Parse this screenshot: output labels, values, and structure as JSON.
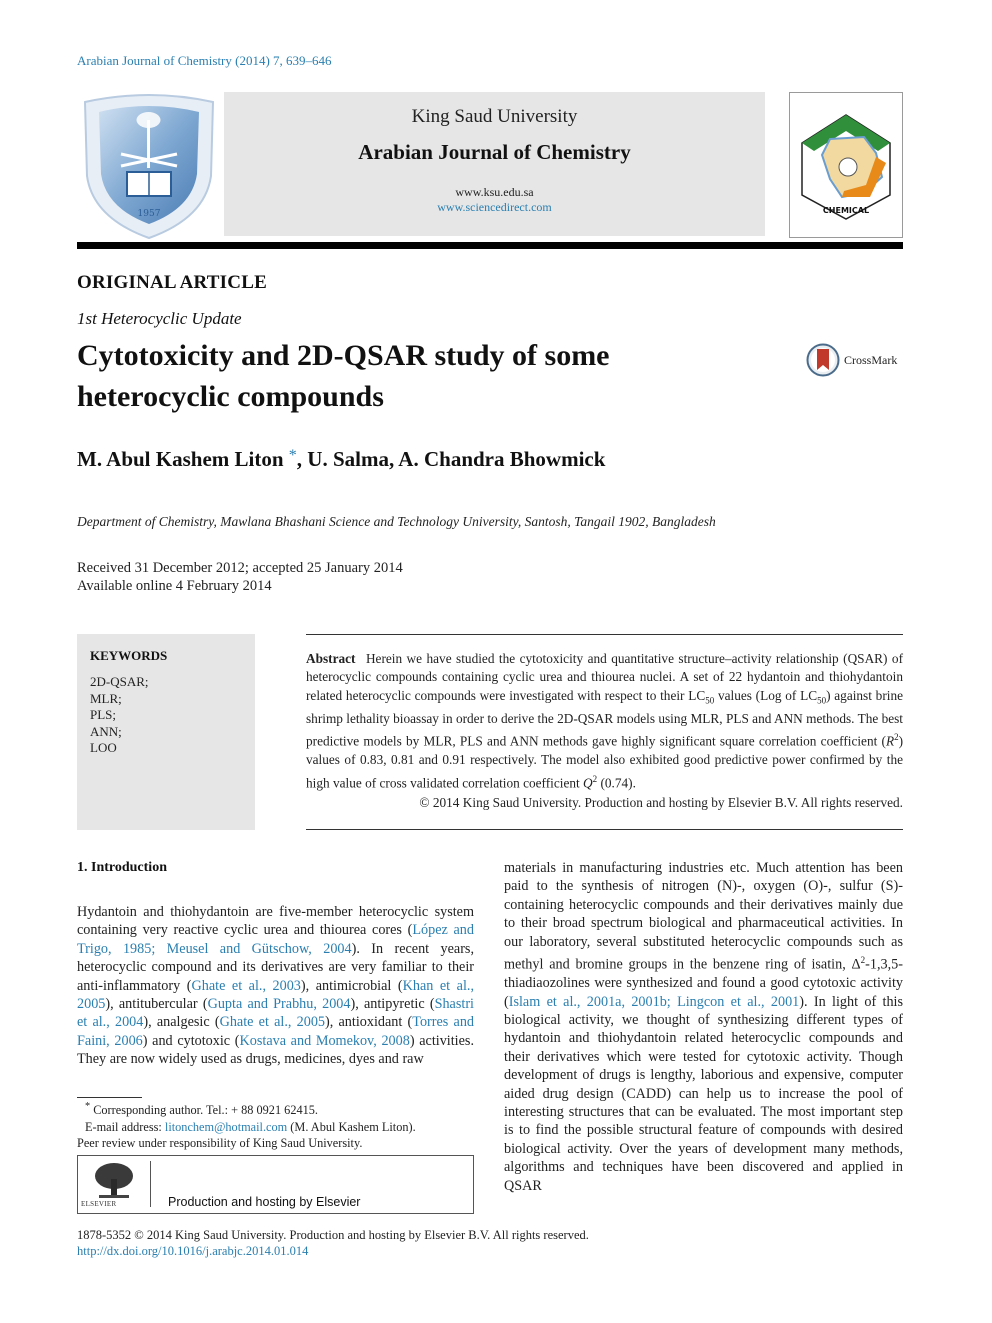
{
  "journal_ref": "Arabian Journal of Chemistry (2014) 7, 639–646",
  "header": {
    "university": "King Saud University",
    "journal_name": "Arabian Journal of Chemistry",
    "url_ksu": "www.ksu.edu.sa",
    "url_sciencedirect": "www.sciencedirect.com",
    "left_logo": "king-saud-university-crest",
    "right_logo": "saudi-chemical-society-emblem",
    "right_logo_text": "CHEMICAL"
  },
  "article": {
    "type": "ORIGINAL ARTICLE",
    "section": "1st Heterocyclic Update",
    "title": "Cytotoxicity and 2D-QSAR study of some heterocyclic compounds",
    "crossmark_label": "CrossMark",
    "authors": "M. Abul Kashem Liton",
    "authors_star": "*",
    "authors_rest": ", U. Salma, A. Chandra Bhowmick",
    "affiliation": "Department of Chemistry, Mawlana Bhashani Science and Technology University, Santosh, Tangail 1902, Bangladesh",
    "received": "Received 31 December 2012; accepted 25 January 2014",
    "available": "Available online 4 February 2014"
  },
  "keywords": {
    "heading": "KEYWORDS",
    "items": [
      "2D-QSAR;",
      "MLR;",
      "PLS;",
      "ANN;",
      "LOO"
    ]
  },
  "abstract": {
    "heading": "Abstract",
    "text_1": "Herein we have studied the cytotoxicity and quantitative structure–activity relationship (QSAR) of heterocyclic compounds containing cyclic urea and thiourea nuclei. A set of 22 hydantoin and thiohydantoin related heterocyclic compounds were investigated with respect to their LC",
    "sub_50": "50",
    "text_2": " values (Log of LC",
    "text_3": ") against brine shrimp lethality bioassay in order to derive the 2D-QSAR models using MLR, PLS and ANN methods. The best predictive models by MLR, PLS and ANN methods gave highly significant square correlation coefficient (",
    "r2_var": "R",
    "sup_2": "2",
    "text_4": ") values of 0.83, 0.81 and 0.91 respectively. The model also exhibited good predictive power confirmed by the high value of cross validated correlation coefficient ",
    "q2_var": "Q",
    "text_5": " (0.74).",
    "copyright": "© 2014 King Saud University. Production and hosting by Elsevier B.V. All rights reserved."
  },
  "introduction": {
    "heading": "1. Introduction",
    "left": [
      {
        "t": "Hydantoin and thiohydantoin are five-member heterocyclic system containing very reactive cyclic urea and thiourea cores ("
      },
      {
        "l": "López and Trigo, 1985; Meusel and Gütschow, 2004"
      },
      {
        "t": "). In recent years, heterocyclic compound and its derivatives are very familiar to their anti-inflammatory ("
      },
      {
        "l": "Ghate et al., 2003"
      },
      {
        "t": "), antimicrobial ("
      },
      {
        "l": "Khan et al., 2005"
      },
      {
        "t": "), antitubercular ("
      },
      {
        "l": "Gupta and Prabhu, 2004"
      },
      {
        "t": "), antipyretic ("
      },
      {
        "l": "Shastri et al., 2004"
      },
      {
        "t": "), analgesic ("
      },
      {
        "l": "Ghate et al., 2005"
      },
      {
        "t": "), antioxidant ("
      },
      {
        "l": "Torres and Faini, 2006"
      },
      {
        "t": ") and cytotoxic ("
      },
      {
        "l": "Kostava and Momekov, 2008"
      },
      {
        "t": ") activities. They are now widely used as drugs, medicines, dyes and raw"
      }
    ],
    "right": [
      {
        "t": "materials in manufacturing industries etc. Much attention has been paid to the synthesis of nitrogen (N)-, oxygen (O)-, sulfur (S)- containing heterocyclic compounds and their derivatives mainly due to their broad spectrum biological and pharmaceutical activities. In our laboratory, several substituted heterocyclic compounds such as methyl and bromine groups in the benzene ring of isatin, Δ"
      },
      {
        "s": "2"
      },
      {
        "t": "-1,3,5-thiadiaozolines were synthesized and found a good cytotoxic activity ("
      },
      {
        "l": "Islam et al., 2001a, 2001b; Lingcon et al., 2001"
      },
      {
        "t": "). In light of this biological activity, we thought of synthesizing different types of hydantoin and thiohydantoin related heterocyclic compounds and their derivatives which were tested for cytotoxic activity. Though development of drugs is lengthy, laborious and expensive, computer aided drug design (CADD) can help us to increase the pool of interesting structures that can be evaluated. The most important step is to find the possible structural feature of compounds with desired biological activity. Over the years of development many methods, algorithms and techniques have been discovered and applied in QSAR"
      }
    ]
  },
  "footnotes": {
    "star": "*",
    "corresponding": " Corresponding author. Tel.: + 88 0921 62415.",
    "email_label": "E-mail address: ",
    "email": "litonchem@hotmail.com",
    "email_suffix": " (M. Abul Kashem Liton).",
    "peer_review": "Peer review under responsibility of King Saud University."
  },
  "elsevier_box": {
    "logo_name": "ELSEVIER",
    "text": "Production and hosting by Elsevier"
  },
  "bottom": {
    "issn_line": "1878-5352 © 2014 King Saud University. Production and hosting by Elsevier B.V. All rights reserved.",
    "doi": "http://dx.doi.org/10.1016/j.arabjc.2014.01.014"
  },
  "colors": {
    "link": "#2a7fb0",
    "header_gray": "#e6e6e6"
  }
}
